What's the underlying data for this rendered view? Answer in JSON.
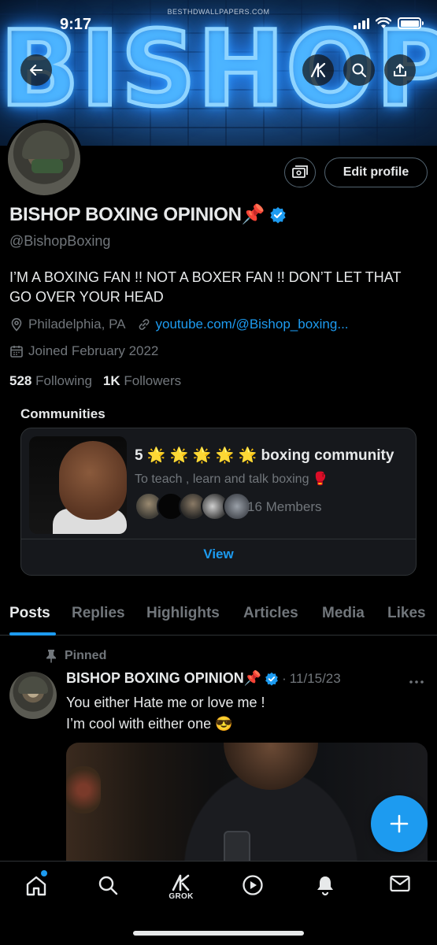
{
  "status_bar": {
    "time": "9:17"
  },
  "banner": {
    "watermark": "BESTHDWALLPAPERS.COM",
    "title": "BISHOP"
  },
  "profile": {
    "display_name": "BISHOP BOXING OPINION📌",
    "handle": "@BishopBoxing",
    "bio": "I’M A BOXING FAN !! NOT A BOXER FAN !! DON’T LET THAT GO OVER YOUR HEAD",
    "location": "Philadelphia, PA",
    "website": "youtube.com/@Bishop_boxing...",
    "joined": "Joined February 2022",
    "following_count": "528",
    "following_label": "Following",
    "followers_count": "1K",
    "followers_label": "Followers",
    "edit_button": "Edit profile"
  },
  "communities": {
    "heading": "Communities",
    "card": {
      "title": "5 🌟 🌟 🌟 🌟 🌟 boxing community",
      "subtitle": "To teach , learn and talk boxing 🥊",
      "members": "16 Members",
      "view_label": "View"
    }
  },
  "tabs": [
    {
      "label": "Posts",
      "active": true
    },
    {
      "label": "Replies"
    },
    {
      "label": "Highlights"
    },
    {
      "label": "Articles"
    },
    {
      "label": "Media"
    },
    {
      "label": "Likes"
    }
  ],
  "post": {
    "pinned_label": "Pinned",
    "author": "BISHOP BOXING OPINION📌",
    "separator": "·",
    "date": "11/15/23",
    "text_line1": "You either Hate me or love me !",
    "text_line2": "I’m cool with either one 😎"
  },
  "bottom_nav": {
    "grok_label": "GROK"
  },
  "colors": {
    "accent": "#1d9bf0",
    "background": "#000000",
    "muted": "#71767b",
    "text": "#e7e9ea"
  }
}
